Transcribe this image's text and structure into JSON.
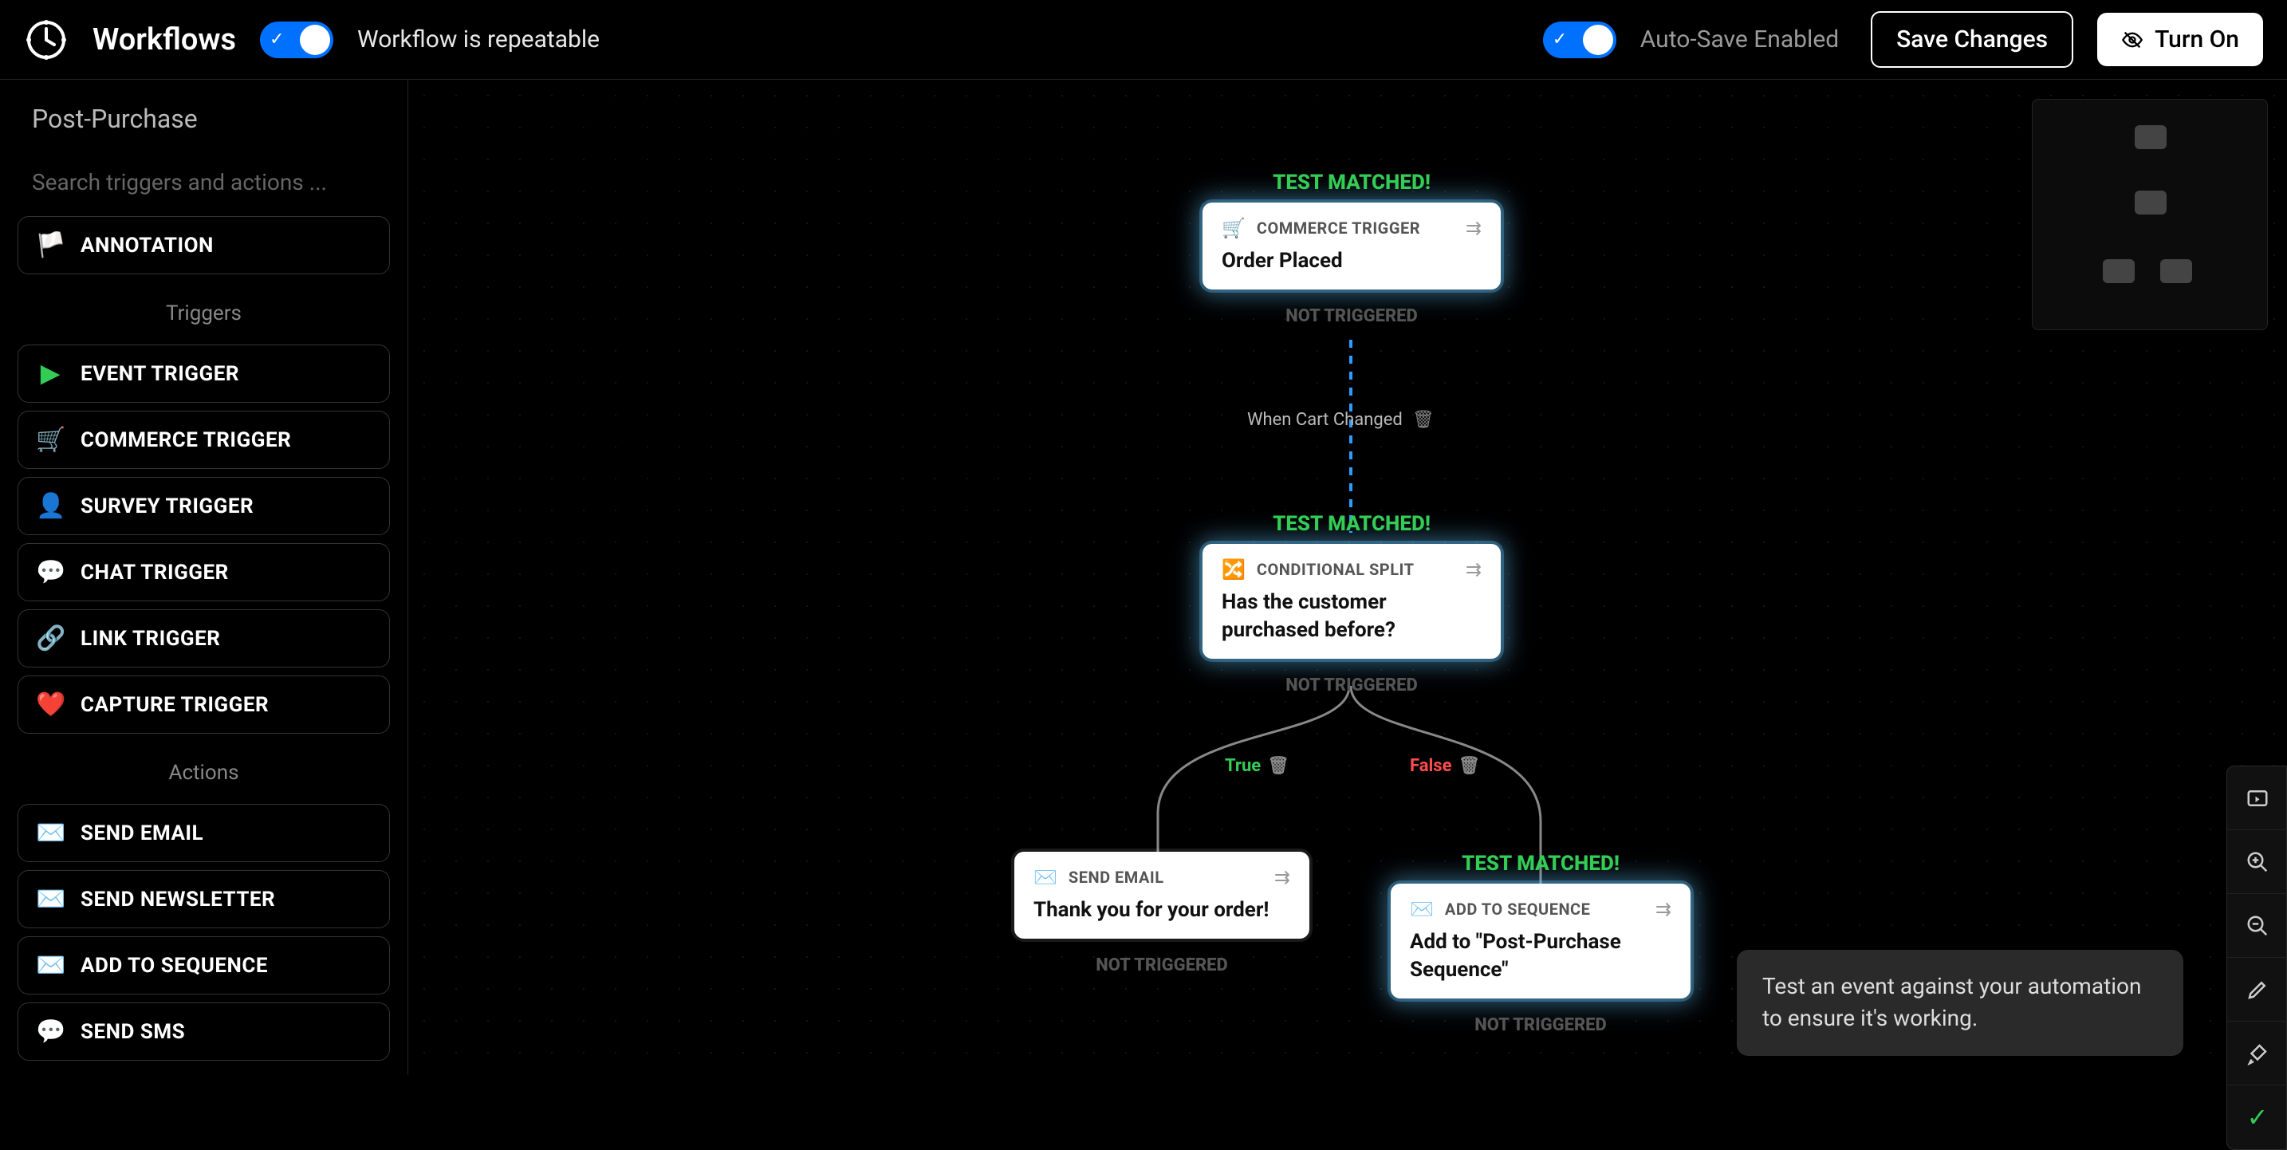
{
  "header": {
    "title": "Workflows",
    "repeatable_label": "Workflow is repeatable",
    "autosave_label": "Auto-Save Enabled",
    "save_label": "Save Changes",
    "turn_on_label": "Turn On"
  },
  "sidebar": {
    "workflow_name": "Post-Purchase",
    "search_placeholder": "Search triggers and actions ...",
    "annotation": {
      "icon": "🏳️",
      "label": "ANNOTATION"
    },
    "section_triggers": "Triggers",
    "section_actions": "Actions",
    "triggers": [
      {
        "icon": "▶",
        "label": "EVENT TRIGGER",
        "icon_color": "#33cc55"
      },
      {
        "icon": "🛒",
        "label": "COMMERCE TRIGGER"
      },
      {
        "icon": "👤",
        "label": "SURVEY TRIGGER"
      },
      {
        "icon": "💬",
        "label": "CHAT TRIGGER"
      },
      {
        "icon": "🔗",
        "label": "LINK TRIGGER"
      },
      {
        "icon": "❤️",
        "label": "CAPTURE TRIGGER"
      }
    ],
    "actions": [
      {
        "icon": "✉️",
        "label": "SEND EMAIL"
      },
      {
        "icon": "✉️",
        "label": "SEND NEWSLETTER"
      },
      {
        "icon": "✉️",
        "label": "ADD TO SEQUENCE"
      },
      {
        "icon": "💬",
        "label": "SEND SMS"
      }
    ]
  },
  "canvas": {
    "status_matched": "TEST MATCHED!",
    "status_not_triggered": "NOT TRIGGERED",
    "branch_true": "True",
    "branch_false": "False",
    "cart_label": "When Cart Changed",
    "nodes": {
      "n1": {
        "icon": "🛒",
        "type": "COMMERCE TRIGGER",
        "title": "Order Placed"
      },
      "n2": {
        "icon": "🔀",
        "type": "CONDITIONAL SPLIT",
        "title": "Has the customer purchased before?"
      },
      "n3": {
        "icon": "✉️",
        "type": "SEND EMAIL",
        "title": "Thank you for your order!"
      },
      "n4": {
        "icon": "✉️",
        "type": "ADD TO SEQUENCE",
        "title": "Add to \"Post-Purchase Sequence\""
      }
    }
  },
  "tooltip": "Test an event against your automation to ensure it's working."
}
